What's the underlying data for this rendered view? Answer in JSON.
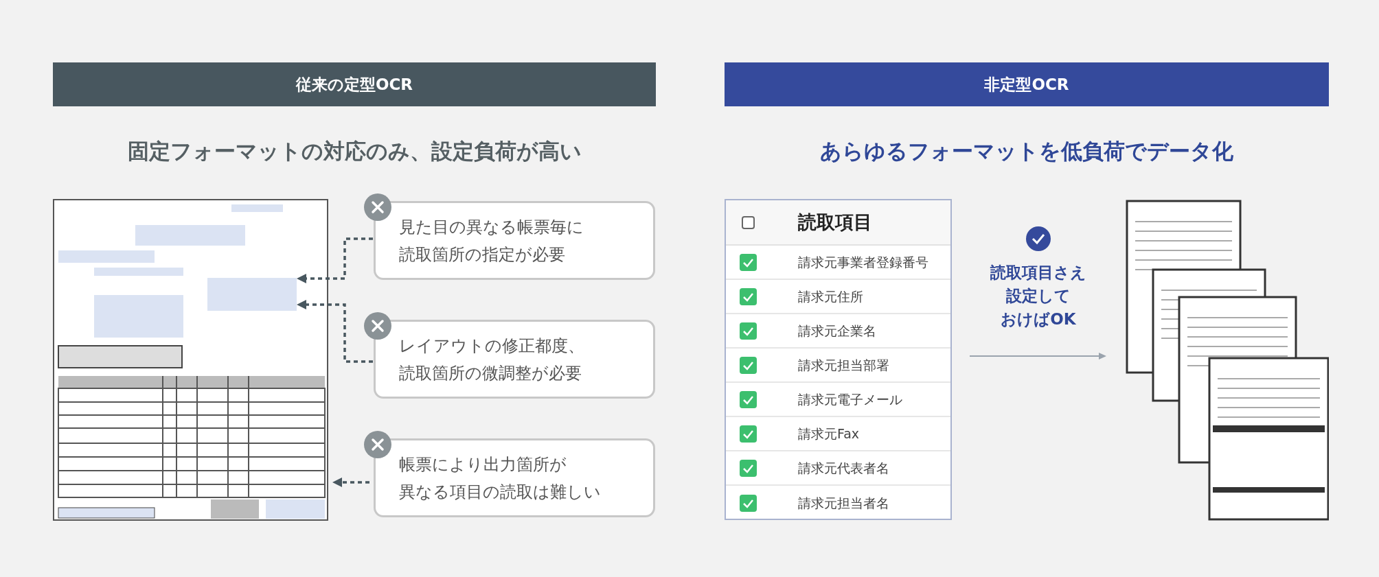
{
  "left_panel": {
    "header": "従来の定型OCR",
    "heading": "固定フォーマットの対応のみ、設定負荷が高い",
    "callouts": [
      {
        "lines": [
          "見た目の異なる帳票毎に",
          "読取箇所の指定が必要"
        ]
      },
      {
        "lines": [
          "レイアウトの修正都度、",
          "読取箇所の微調整が必要"
        ]
      },
      {
        "lines": [
          "帳票により出力箇所が",
          "異なる項目の読取は難しい"
        ]
      }
    ]
  },
  "right_panel": {
    "header": "非定型OCR",
    "heading": "あらゆるフォーマットを低負荷でデータ化",
    "checklist": {
      "header": {
        "label": "読取項目",
        "checked": false
      },
      "items": [
        {
          "label": "請求元事業者登録番号",
          "checked": true
        },
        {
          "label": "請求元住所",
          "checked": true
        },
        {
          "label": "請求元企業名",
          "checked": true
        },
        {
          "label": "請求元担当部署",
          "checked": true
        },
        {
          "label": "請求元電子メール",
          "checked": true
        },
        {
          "label": "請求元Fax",
          "checked": true
        },
        {
          "label": "請求元代表者名",
          "checked": true
        },
        {
          "label": "請求元担当者名",
          "checked": true
        }
      ]
    },
    "note": [
      "読取項目さえ",
      "設定して",
      "おけばOK"
    ]
  }
}
